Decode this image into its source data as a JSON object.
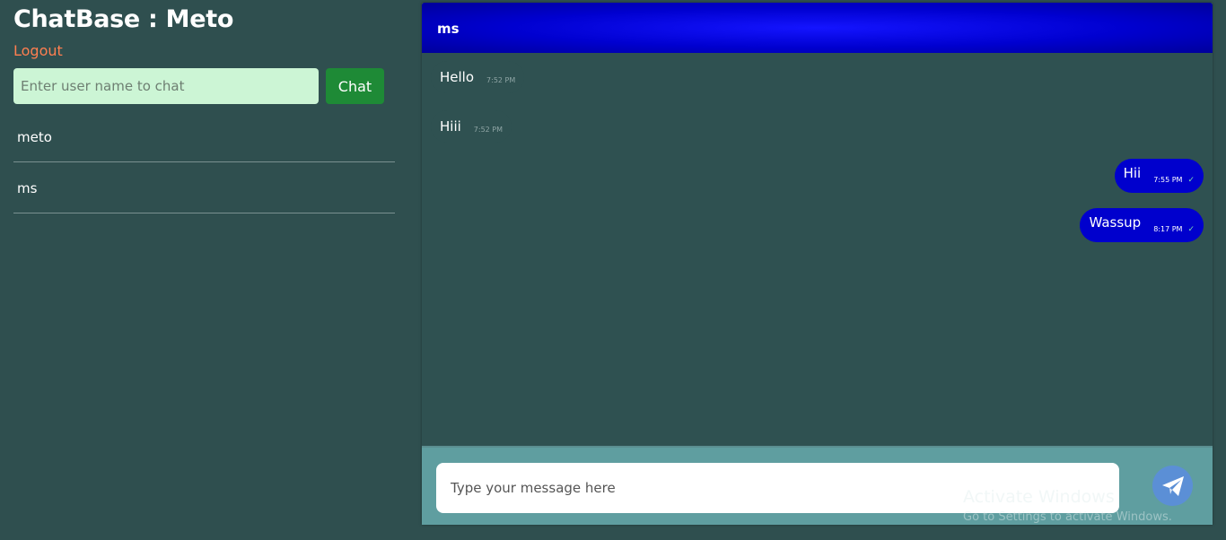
{
  "app": {
    "title": "ChatBase : Meto"
  },
  "sidebar": {
    "logout_label": "Logout",
    "search_placeholder": "Enter user name to chat",
    "search_value": "",
    "chat_button_label": "Chat",
    "users": [
      {
        "name": "meto"
      },
      {
        "name": "ms"
      }
    ]
  },
  "chat": {
    "contact_name": "ms",
    "messages": [
      {
        "direction": "incoming",
        "text": "Hello",
        "time": "7:52 PM"
      },
      {
        "direction": "incoming",
        "text": "Hiii",
        "time": "7:52 PM"
      },
      {
        "direction": "outgoing",
        "text": "Hii",
        "time": "7:55 PM",
        "status": "✓"
      },
      {
        "direction": "outgoing",
        "text": "Wassup",
        "time": "8:17 PM",
        "status": "✓"
      }
    ],
    "composer": {
      "placeholder": "Type your message here",
      "value": "",
      "send_icon": "paper-plane-icon"
    }
  },
  "watermark": {
    "title": "Activate Windows",
    "subtitle": "Go to Settings to activate Windows."
  },
  "colors": {
    "background": "#2f4f4f",
    "header_blue": "#0000cd",
    "outgoing_bubble": "#0000cd",
    "composer_bg": "#5f9ea0",
    "chat_button": "#1e8a36",
    "search_bg": "#ccf5d5",
    "logout": "#ff7f50",
    "send_button": "#5b8fd6"
  }
}
